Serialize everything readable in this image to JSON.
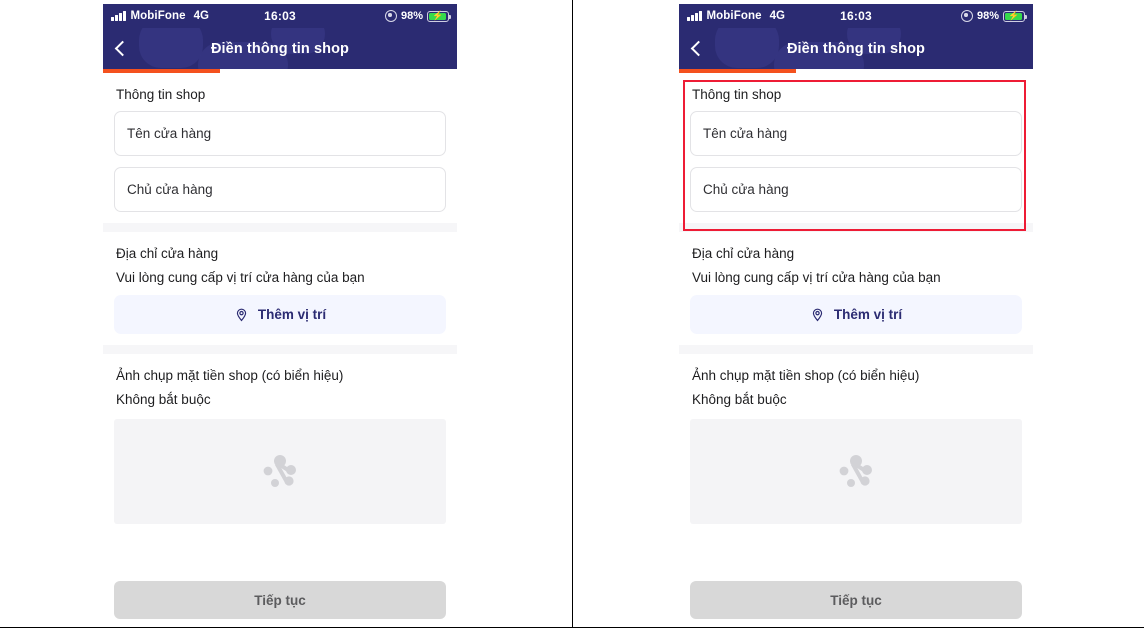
{
  "screens": [
    {
      "id": "left",
      "annotated": false
    },
    {
      "id": "right",
      "annotated": true
    }
  ],
  "status_bar": {
    "signal_icon": "signal-bars-icon",
    "carrier": "MobiFone",
    "network": "4G",
    "time": "16:03",
    "location_icon": "location-services-icon",
    "battery_percent": "98%",
    "battery_icon": "battery-charging-icon",
    "charging_glyph": "⚡"
  },
  "nav": {
    "back_icon": "chevron-left-icon",
    "title": "Điền thông tin shop"
  },
  "progress": {
    "percent": 33,
    "fill_color": "#f4511e",
    "track_color": "#ffffff"
  },
  "sections": {
    "shop_info": {
      "title": "Thông tin shop",
      "fields": [
        {
          "name": "shop-name-field",
          "value": "Tên cửa hàng"
        },
        {
          "name": "shop-owner-field",
          "value": "Chủ cửa hàng"
        }
      ]
    },
    "address": {
      "title": "Địa chỉ cửa hàng",
      "subtitle": "Vui lòng cung cấp vị trí cửa hàng của bạn",
      "button_label": "Thêm vị trí",
      "button_icon": "map-pin-icon"
    },
    "photo": {
      "title": "Ảnh chụp mặt tiền shop (có biển hiệu)",
      "subtitle": "Không bắt buộc",
      "placeholder_icon": "image-placeholder-icon"
    }
  },
  "footer": {
    "continue_label": "Tiếp tục",
    "continue_disabled": true
  },
  "annotation": {
    "type": "rectangle-highlight",
    "color": "#ee1c35",
    "target": "shop-info-section"
  },
  "colors": {
    "navbar": "#2b2b72",
    "accent_orange": "#f4511e",
    "button_bg": "#f4f6ff",
    "button_text": "#2b2b72",
    "disabled_button": "#d8d8d8",
    "annotation_red": "#ee1c35",
    "battery_green": "#35d94c"
  }
}
